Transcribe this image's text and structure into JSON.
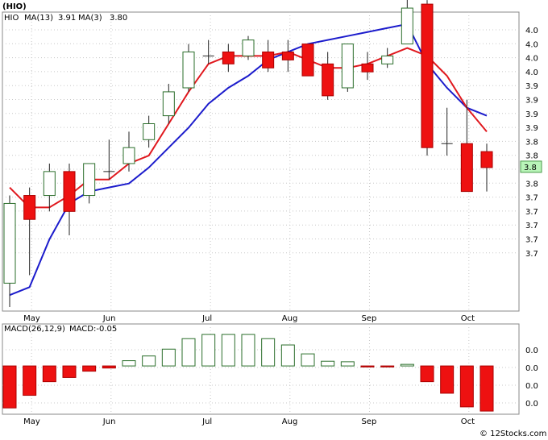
{
  "chart_data": [
    {
      "type": "candlestick",
      "ticker": "(HIO)",
      "legend": {
        "ticker": "HIO",
        "ma13": "MA(13)",
        "ma13_value": "3.91",
        "ma3": "MA(3)",
        "ma3_value": "3.80"
      },
      "y_tick_labels": [
        "4.0",
        "4.0",
        "4.0",
        "4.0",
        "3.9",
        "3.9",
        "3.9",
        "3.9",
        "3.8",
        "3.8",
        "3.8",
        "3.8",
        "3.7",
        "3.7",
        "3.7",
        "3.7",
        "3.7"
      ],
      "last_price_label": "3.8",
      "x_labels": [
        "May",
        "Jun",
        "Jul",
        "Aug",
        "Sep",
        "Oct"
      ],
      "ylim": [
        3.685,
        4.06
      ],
      "candles": [
        {
          "o": 3.72,
          "c": 3.82,
          "h": 3.83,
          "l": 3.69
        },
        {
          "o": 3.83,
          "c": 3.8,
          "h": 3.84,
          "l": 3.73
        },
        {
          "o": 3.83,
          "c": 3.86,
          "h": 3.87,
          "l": 3.81
        },
        {
          "o": 3.86,
          "c": 3.81,
          "h": 3.87,
          "l": 3.78
        },
        {
          "o": 3.83,
          "c": 3.87,
          "h": 3.87,
          "l": 3.82
        },
        {
          "o": 3.86,
          "c": 3.86,
          "h": 3.9,
          "l": 3.85
        },
        {
          "o": 3.87,
          "c": 3.89,
          "h": 3.91,
          "l": 3.86
        },
        {
          "o": 3.9,
          "c": 3.92,
          "h": 3.93,
          "l": 3.89
        },
        {
          "o": 3.93,
          "c": 3.96,
          "h": 3.97,
          "l": 3.92
        },
        {
          "o": 3.965,
          "c": 4.01,
          "h": 4.02,
          "l": 3.96
        },
        {
          "o": 4.005,
          "c": 4.005,
          "h": 4.025,
          "l": 3.995
        },
        {
          "o": 4.01,
          "c": 3.995,
          "h": 4.02,
          "l": 3.985
        },
        {
          "o": 4.005,
          "c": 4.025,
          "h": 4.03,
          "l": 4.0
        },
        {
          "o": 4.01,
          "c": 3.99,
          "h": 4.025,
          "l": 3.985
        },
        {
          "o": 4.01,
          "c": 4.0,
          "h": 4.025,
          "l": 3.985
        },
        {
          "o": 4.02,
          "c": 3.98,
          "h": 4.02,
          "l": 3.98
        },
        {
          "o": 3.995,
          "c": 3.955,
          "h": 4.01,
          "l": 3.95
        },
        {
          "o": 3.965,
          "c": 4.02,
          "h": 4.02,
          "l": 3.96
        },
        {
          "o": 3.995,
          "c": 3.985,
          "h": 4.01,
          "l": 3.975
        },
        {
          "o": 3.995,
          "c": 4.005,
          "h": 4.015,
          "l": 3.99
        },
        {
          "o": 4.02,
          "c": 4.065,
          "h": 4.08,
          "l": 4.02
        },
        {
          "o": 4.07,
          "c": 3.89,
          "h": 4.075,
          "l": 3.88
        },
        {
          "o": 3.895,
          "c": 3.895,
          "h": 3.94,
          "l": 3.88
        },
        {
          "o": 3.895,
          "c": 3.835,
          "h": 3.95,
          "l": 3.835
        },
        {
          "o": 3.885,
          "c": 3.865,
          "h": 3.895,
          "l": 3.835
        }
      ],
      "ma13": [
        3.705,
        3.715,
        3.775,
        3.82,
        3.835,
        3.84,
        3.845,
        3.865,
        3.89,
        3.915,
        3.945,
        3.965,
        3.98,
        4.0,
        4.01,
        4.02,
        4.025,
        4.03,
        4.035,
        4.04,
        4.045,
        3.995,
        3.965,
        3.94,
        3.93
      ],
      "ma3": [
        3.84,
        3.815,
        3.815,
        3.83,
        3.85,
        3.85,
        3.87,
        3.88,
        3.92,
        3.96,
        3.995,
        4.005,
        4.005,
        4.005,
        4.01,
        4.0,
        3.99,
        3.99,
        3.995,
        4.005,
        4.015,
        4.005,
        3.98,
        3.94,
        3.91
      ],
      "macd": {
        "label": "MACD(26,12,9)",
        "value_label": "MACD:-0.05",
        "y_tick_labels": [
          "0.0",
          "0.0",
          "0.0",
          "0.0"
        ],
        "values": [
          -0.04,
          -0.028,
          -0.015,
          -0.011,
          -0.005,
          -0.002,
          0.005,
          0.0095,
          0.016,
          0.026,
          0.03,
          0.03,
          0.03,
          0.026,
          0.02,
          0.0115,
          0.0045,
          0.004,
          -0.001,
          -0.001,
          0.0015,
          -0.015,
          -0.026,
          -0.039,
          -0.043
        ]
      }
    }
  ]
}
